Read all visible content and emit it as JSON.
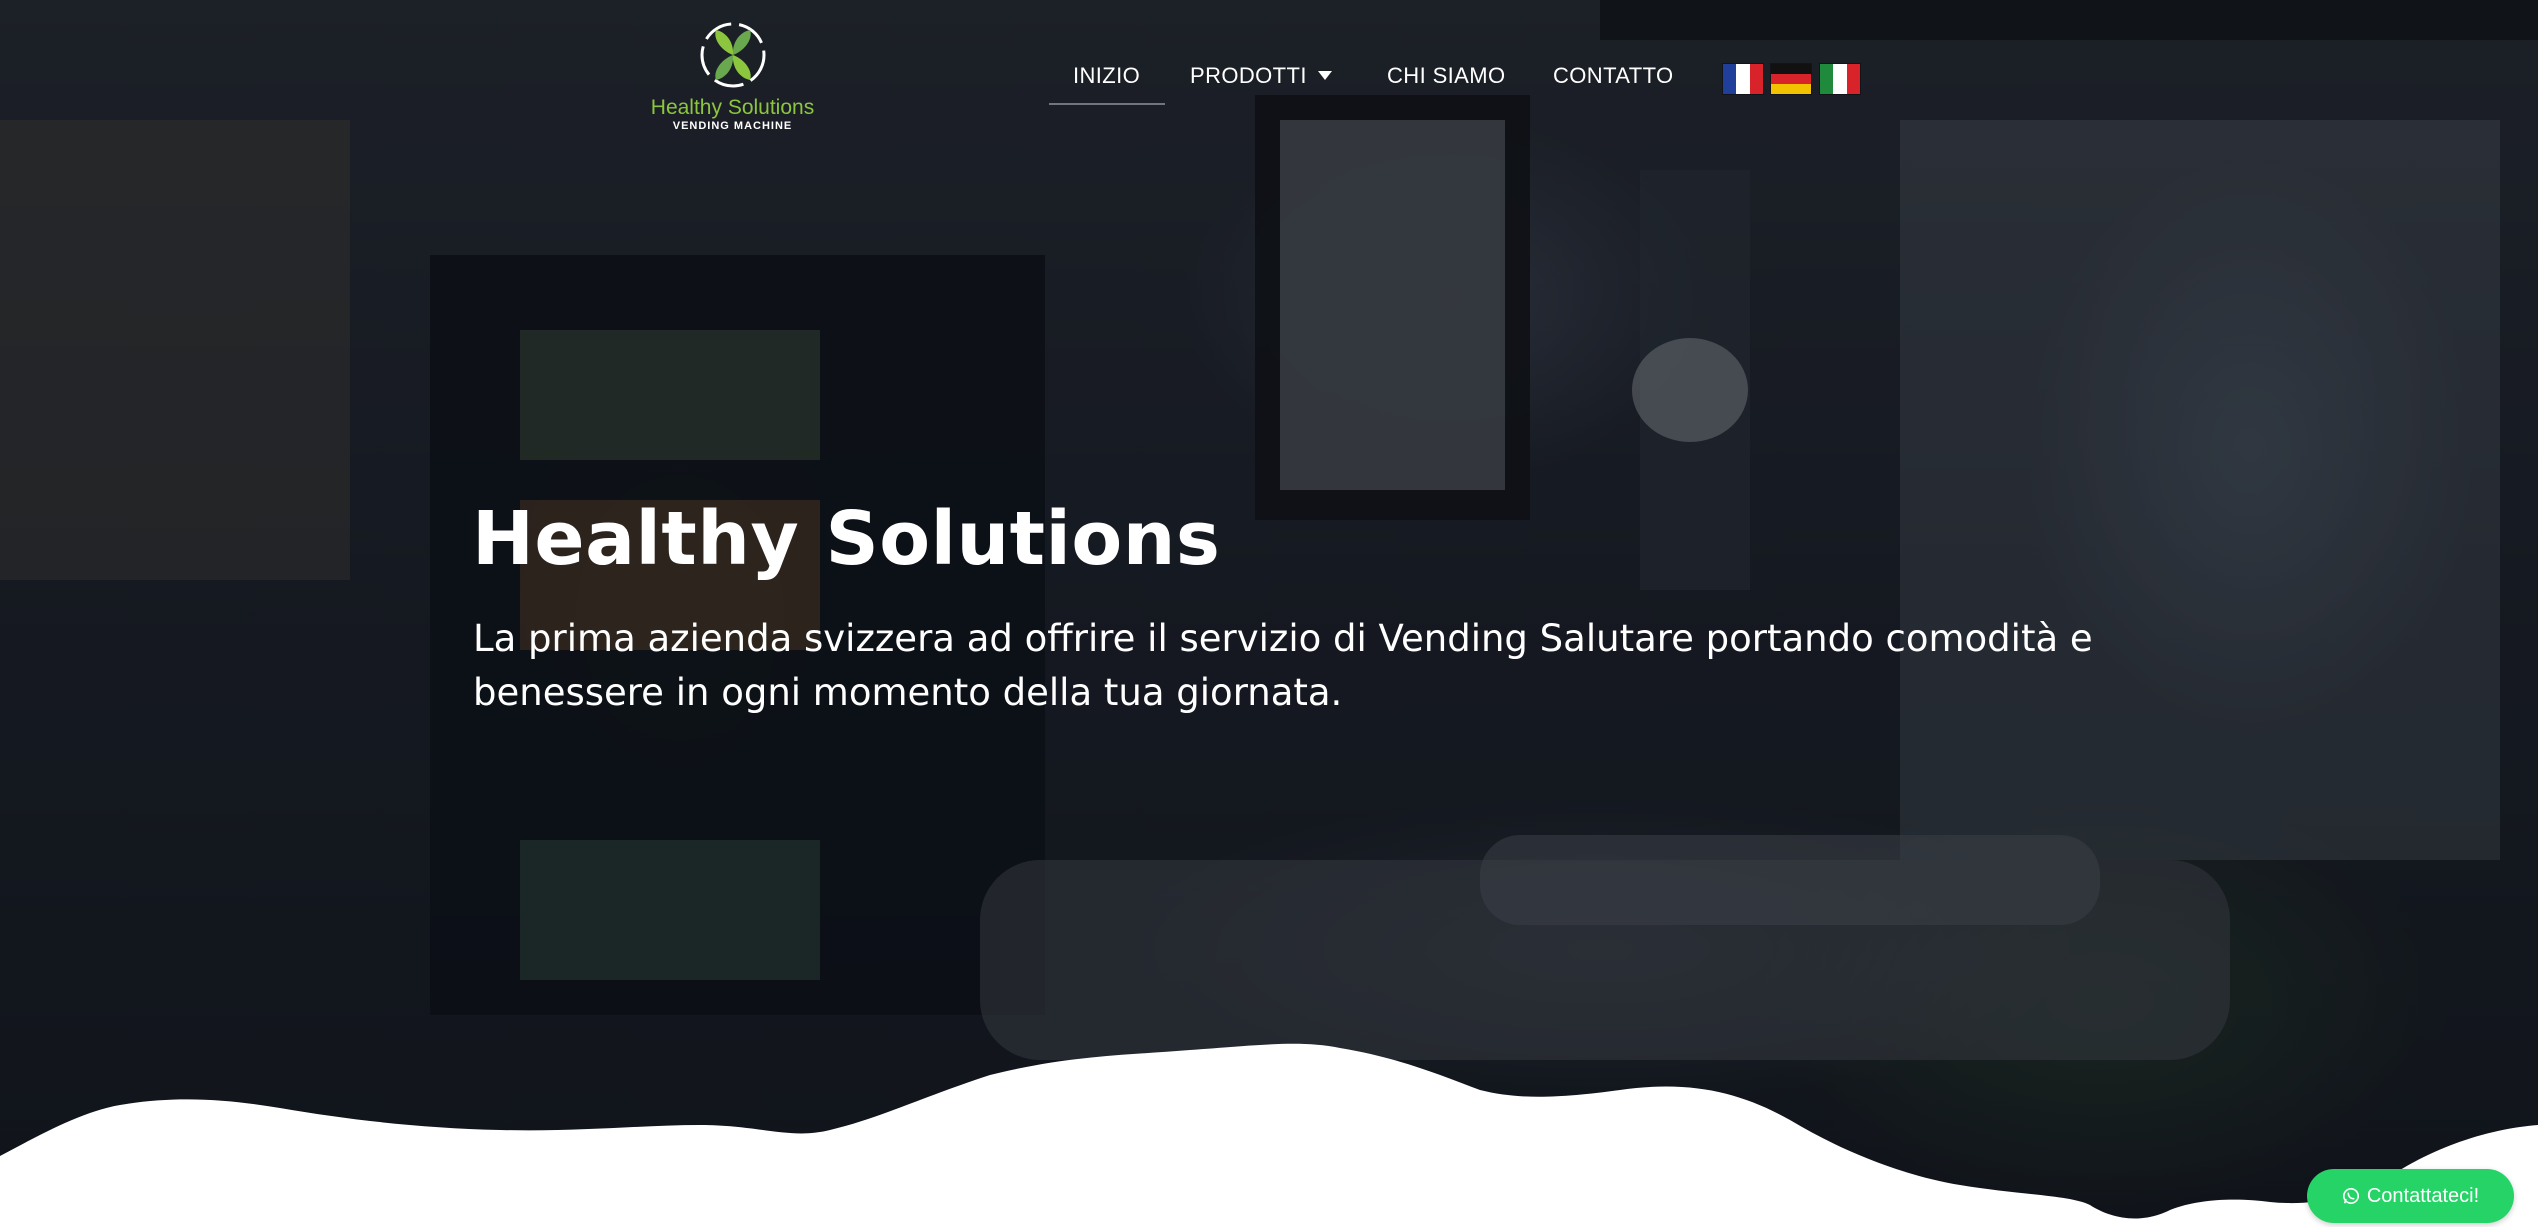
{
  "brand": {
    "name": "Healthy Solutions",
    "tagline": "VENDING MACHINE",
    "accent_color": "#8cc63f"
  },
  "nav": {
    "items": [
      {
        "label": "INIZIO",
        "active": true
      },
      {
        "label": "PRODOTTI",
        "has_dropdown": true
      },
      {
        "label": "CHI SIAMO"
      },
      {
        "label": "CONTATTO"
      }
    ],
    "languages": [
      {
        "code": "fr",
        "icon": "france-flag-icon"
      },
      {
        "code": "de",
        "icon": "germany-flag-icon"
      },
      {
        "code": "it",
        "icon": "italy-flag-icon"
      }
    ]
  },
  "hero": {
    "title": "Healthy Solutions",
    "subtitle": "La prima azienda svizzera ad offrire il servizio di Vending Salutare portando comodità e benessere in ogni momento della tua giornata."
  },
  "whatsapp": {
    "label": "Contattateci!",
    "icon": "whatsapp-icon",
    "color": "#25d366"
  }
}
